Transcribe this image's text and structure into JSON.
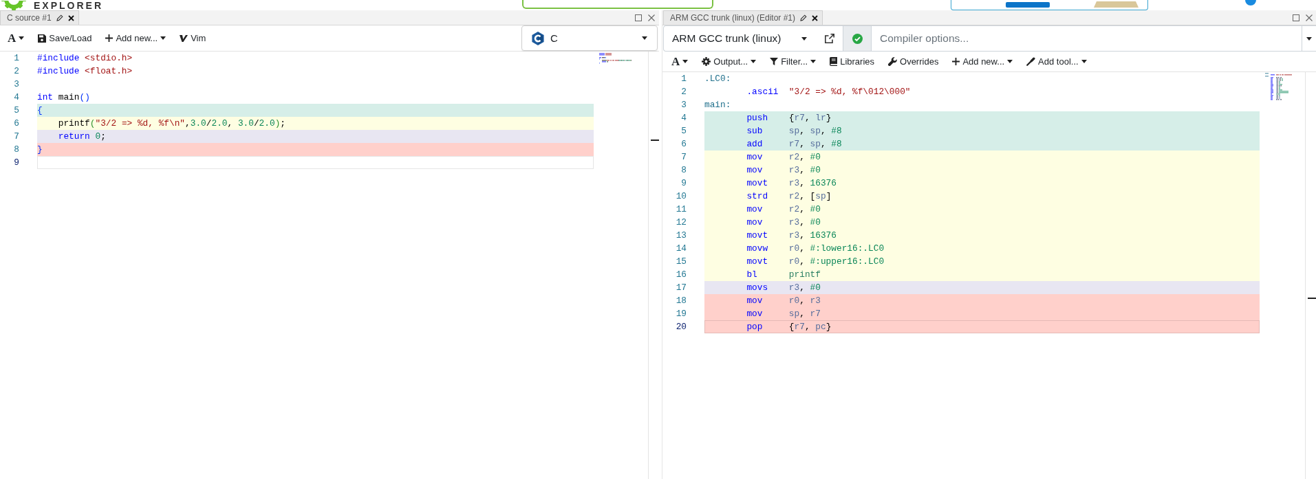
{
  "header": {
    "logo_text": "EXPLORER"
  },
  "source_pane": {
    "tab": {
      "title": "C source #1",
      "selected": true
    },
    "toolbar": [
      {
        "kind": "font",
        "label": "A",
        "dropdown": true
      },
      {
        "kind": "save",
        "label": "Save/Load",
        "dropdown": false
      },
      {
        "kind": "add",
        "label": "Add new...",
        "dropdown": true
      },
      {
        "kind": "vim",
        "label": "Vim",
        "dropdown": false
      }
    ],
    "language": "C",
    "lines": [
      {
        "number": "1",
        "tokens": [
          {
            "kind": "keyword",
            "text": "#include"
          },
          {
            "kind": "string",
            "text": " <stdio.h>"
          }
        ],
        "current": false
      },
      {
        "number": "2",
        "tokens": [
          {
            "kind": "keyword",
            "text": "#include"
          },
          {
            "kind": "string",
            "text": " <float.h>"
          }
        ],
        "current": false
      },
      {
        "number": "3",
        "current": false
      },
      {
        "number": "4",
        "tokens": [
          {
            "kind": "keyword",
            "text": "int"
          },
          {
            "kind": "plain",
            "text": " main"
          },
          {
            "kind": "bracket",
            "text": "()"
          }
        ],
        "current": false
      },
      {
        "number": "5",
        "tokens": [
          {
            "kind": "bracket",
            "text": "{"
          }
        ],
        "color": "#d6eee8",
        "current": false
      },
      {
        "number": "6",
        "tokens": [
          {
            "kind": "plain",
            "text": "    printf"
          },
          {
            "kind": "paren",
            "text": "("
          },
          {
            "kind": "string",
            "text": "\"3/2 => %d, %f\\n\""
          },
          {
            "kind": "plain",
            "text": ","
          },
          {
            "kind": "number",
            "text": "3.0"
          },
          {
            "kind": "plain",
            "text": "/"
          },
          {
            "kind": "number",
            "text": "2.0"
          },
          {
            "kind": "plain",
            "text": ", "
          },
          {
            "kind": "number",
            "text": "3.0"
          },
          {
            "kind": "plain",
            "text": "/"
          },
          {
            "kind": "number",
            "text": "2.0"
          },
          {
            "kind": "paren",
            "text": ")"
          },
          {
            "kind": "plain",
            "text": ";"
          }
        ],
        "color": "#fefee2",
        "current": false
      },
      {
        "number": "7",
        "tokens": [
          {
            "kind": "keyword",
            "text": "    return"
          },
          {
            "kind": "number",
            "text": " 0"
          },
          {
            "kind": "plain",
            "text": ";"
          }
        ],
        "color": "#e8e6f2",
        "current": false
      },
      {
        "number": "8",
        "tokens": [
          {
            "kind": "bracket",
            "text": "}"
          }
        ],
        "color": "#ffd0cb",
        "current": false
      },
      {
        "number": "9",
        "current": true
      }
    ]
  },
  "compiler_pane": {
    "tab": {
      "title": "ARM GCC trunk (linux) (Editor #1)",
      "selected": true
    },
    "compiler": "ARM GCC trunk (linux)",
    "compile_succeeded": true,
    "options": {
      "placeholder": "Compiler options..."
    },
    "toolbar": [
      {
        "kind": "font",
        "label": "A",
        "dropdown": true
      },
      {
        "kind": "output",
        "label": "Output...",
        "dropdown": true
      },
      {
        "kind": "filter",
        "label": "Filter...",
        "dropdown": true
      },
      {
        "kind": "libraries",
        "label": "Libraries",
        "dropdown": false
      },
      {
        "kind": "overrides",
        "label": "Overrides",
        "dropdown": false
      },
      {
        "kind": "add",
        "label": "Add new...",
        "dropdown": true
      },
      {
        "kind": "tool",
        "label": "Add tool...",
        "dropdown": true
      }
    ],
    "lines": [
      {
        "number": "1",
        "tokens": [
          {
            "kind": "label",
            "text": ".LC0:"
          }
        ],
        "current": false
      },
      {
        "number": "2",
        "tokens": [
          {
            "kind": "directive",
            "text": ".ascii"
          },
          {
            "kind": "string",
            "text": "\"3/2 => %d, %f\\012\\000\""
          }
        ],
        "current": false
      },
      {
        "number": "3",
        "tokens": [
          {
            "kind": "label",
            "text": "main:"
          }
        ],
        "current": false
      },
      {
        "number": "4",
        "tokens": [
          {
            "kind": "instruction",
            "text": "push"
          },
          {
            "kind": "plain",
            "text": "{"
          },
          {
            "kind": "register",
            "text": "r7"
          },
          {
            "kind": "plain",
            "text": ", "
          },
          {
            "kind": "register",
            "text": "lr"
          },
          {
            "kind": "plain",
            "text": "}"
          }
        ],
        "color": "#d6eee8",
        "current": false
      },
      {
        "number": "5",
        "tokens": [
          {
            "kind": "instruction",
            "text": "sub"
          },
          {
            "kind": "register",
            "text": "sp"
          },
          {
            "kind": "plain",
            "text": ", "
          },
          {
            "kind": "register",
            "text": "sp"
          },
          {
            "kind": "plain",
            "text": ", "
          },
          {
            "kind": "number",
            "text": "#8"
          }
        ],
        "color": "#d6eee8",
        "current": false
      },
      {
        "number": "6",
        "tokens": [
          {
            "kind": "instruction",
            "text": "add"
          },
          {
            "kind": "register",
            "text": "r7"
          },
          {
            "kind": "plain",
            "text": ", "
          },
          {
            "kind": "register",
            "text": "sp"
          },
          {
            "kind": "plain",
            "text": ", "
          },
          {
            "kind": "number",
            "text": "#8"
          }
        ],
        "color": "#d6eee8",
        "current": false
      },
      {
        "number": "7",
        "tokens": [
          {
            "kind": "instruction",
            "text": "mov"
          },
          {
            "kind": "register",
            "text": "r2"
          },
          {
            "kind": "plain",
            "text": ", "
          },
          {
            "kind": "number",
            "text": "#0"
          }
        ],
        "color": "#fefee2",
        "current": false
      },
      {
        "number": "8",
        "tokens": [
          {
            "kind": "instruction",
            "text": "mov"
          },
          {
            "kind": "register",
            "text": "r3"
          },
          {
            "kind": "plain",
            "text": ", "
          },
          {
            "kind": "number",
            "text": "#0"
          }
        ],
        "color": "#fefee2",
        "current": false
      },
      {
        "number": "9",
        "tokens": [
          {
            "kind": "instruction",
            "text": "movt"
          },
          {
            "kind": "register",
            "text": "r3"
          },
          {
            "kind": "plain",
            "text": ", "
          },
          {
            "kind": "number",
            "text": "16376"
          }
        ],
        "color": "#fefee2",
        "current": false
      },
      {
        "number": "10",
        "tokens": [
          {
            "kind": "instruction",
            "text": "strd"
          },
          {
            "kind": "register",
            "text": "r2"
          },
          {
            "kind": "plain",
            "text": ", ["
          },
          {
            "kind": "register",
            "text": "sp"
          },
          {
            "kind": "plain",
            "text": "]"
          }
        ],
        "color": "#fefee2",
        "current": false
      },
      {
        "number": "11",
        "tokens": [
          {
            "kind": "instruction",
            "text": "mov"
          },
          {
            "kind": "register",
            "text": "r2"
          },
          {
            "kind": "plain",
            "text": ", "
          },
          {
            "kind": "number",
            "text": "#0"
          }
        ],
        "color": "#fefee2",
        "current": false
      },
      {
        "number": "12",
        "tokens": [
          {
            "kind": "instruction",
            "text": "mov"
          },
          {
            "kind": "register",
            "text": "r3"
          },
          {
            "kind": "plain",
            "text": ", "
          },
          {
            "kind": "number",
            "text": "#0"
          }
        ],
        "color": "#fefee2",
        "current": false
      },
      {
        "number": "13",
        "tokens": [
          {
            "kind": "instruction",
            "text": "movt"
          },
          {
            "kind": "register",
            "text": "r3"
          },
          {
            "kind": "plain",
            "text": ", "
          },
          {
            "kind": "number",
            "text": "16376"
          }
        ],
        "color": "#fefee2",
        "current": false
      },
      {
        "number": "14",
        "tokens": [
          {
            "kind": "instruction",
            "text": "movw"
          },
          {
            "kind": "register",
            "text": "r0"
          },
          {
            "kind": "plain",
            "text": ", "
          },
          {
            "kind": "number",
            "text": "#:lower16:.LC0"
          }
        ],
        "color": "#fefee2",
        "current": false
      },
      {
        "number": "15",
        "tokens": [
          {
            "kind": "instruction",
            "text": "movt"
          },
          {
            "kind": "register",
            "text": "r0"
          },
          {
            "kind": "plain",
            "text": ", "
          },
          {
            "kind": "number",
            "text": "#:upper16:.LC0"
          }
        ],
        "color": "#fefee2",
        "current": false
      },
      {
        "number": "16",
        "tokens": [
          {
            "kind": "instruction",
            "text": "bl"
          },
          {
            "kind": "symbol",
            "text": "printf"
          }
        ],
        "color": "#fefee2",
        "current": false
      },
      {
        "number": "17",
        "tokens": [
          {
            "kind": "instruction",
            "text": "movs"
          },
          {
            "kind": "register",
            "text": "r3"
          },
          {
            "kind": "plain",
            "text": ", "
          },
          {
            "kind": "number",
            "text": "#0"
          }
        ],
        "color": "#e8e6f2",
        "current": false
      },
      {
        "number": "18",
        "tokens": [
          {
            "kind": "instruction",
            "text": "mov"
          },
          {
            "kind": "register",
            "text": "r0"
          },
          {
            "kind": "plain",
            "text": ", "
          },
          {
            "kind": "register",
            "text": "r3"
          }
        ],
        "color": "#ffd0cb",
        "current": false
      },
      {
        "number": "19",
        "tokens": [
          {
            "kind": "instruction",
            "text": "mov"
          },
          {
            "kind": "register",
            "text": "sp"
          },
          {
            "kind": "plain",
            "text": ", "
          },
          {
            "kind": "register",
            "text": "r7"
          }
        ],
        "color": "#ffd0cb",
        "current": false
      },
      {
        "number": "20",
        "tokens": [
          {
            "kind": "instruction",
            "text": "pop"
          },
          {
            "kind": "plain",
            "text": "{"
          },
          {
            "kind": "register",
            "text": "r7"
          },
          {
            "kind": "plain",
            "text": ", "
          },
          {
            "kind": "register",
            "text": "pc"
          },
          {
            "kind": "plain",
            "text": "}"
          }
        ],
        "color": "#ffd0cb",
        "current": true
      }
    ]
  }
}
